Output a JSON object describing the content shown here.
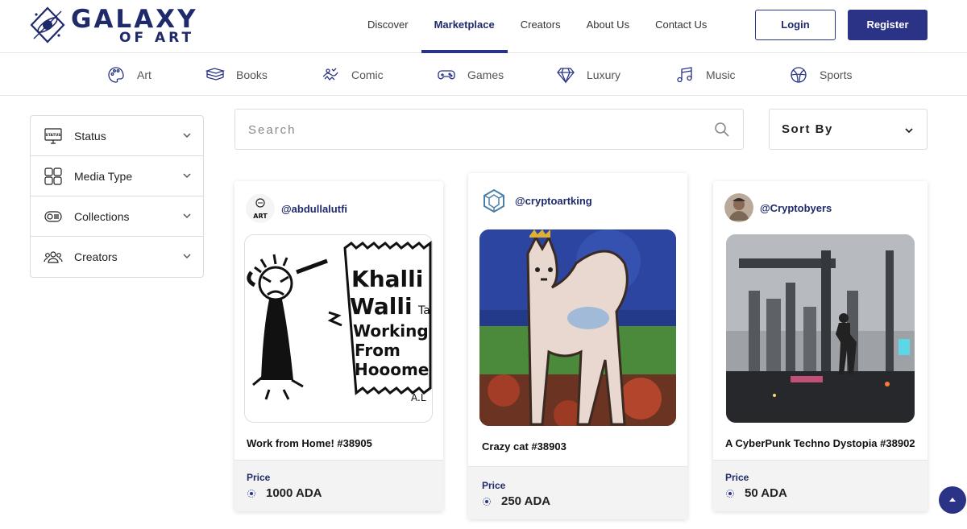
{
  "brand": {
    "line1": "GALAXY",
    "line2": "OF ART"
  },
  "nav": [
    {
      "label": "Discover",
      "active": false
    },
    {
      "label": "Marketplace",
      "active": true
    },
    {
      "label": "Creators",
      "active": false
    },
    {
      "label": "About Us",
      "active": false
    },
    {
      "label": "Contact Us",
      "active": false
    }
  ],
  "auth": {
    "login": "Login",
    "register": "Register"
  },
  "categories": [
    {
      "label": "Art",
      "icon": "palette-icon"
    },
    {
      "label": "Books",
      "icon": "books-icon"
    },
    {
      "label": "Comic",
      "icon": "comic-icon"
    },
    {
      "label": "Games",
      "icon": "gamepad-icon"
    },
    {
      "label": "Luxury",
      "icon": "diamond-icon"
    },
    {
      "label": "Music",
      "icon": "music-note-icon"
    },
    {
      "label": "Sports",
      "icon": "ball-icon"
    }
  ],
  "filters": [
    {
      "label": "Status",
      "icon": "status-icon"
    },
    {
      "label": "Media Type",
      "icon": "grid-icon"
    },
    {
      "label": "Collections",
      "icon": "collection-icon"
    },
    {
      "label": "Creators",
      "icon": "people-icon"
    }
  ],
  "search": {
    "placeholder": "Search"
  },
  "sort": {
    "label": "Sort By"
  },
  "cards": [
    {
      "creator": "@abdullalutfi",
      "avatar_text": "ART",
      "title": "Work from Home! #38905",
      "price_label": "Price",
      "price": "1000 ADA",
      "art_text": [
        "Khalli",
        "Walli",
        "Working",
        "From",
        "Hooome"
      ],
      "signature": "A.L",
      "art_side_text": "Ta"
    },
    {
      "creator": "@cryptoartking",
      "title": "Crazy cat #38903",
      "price_label": "Price",
      "price": "250 ADA"
    },
    {
      "creator": "@Cryptobyers",
      "title": "A CyberPunk Techno Dystopia #38902",
      "price_label": "Price",
      "price": "50 ADA"
    }
  ],
  "colors": {
    "brand": "#1f2a6b",
    "accent": "#2a3385"
  }
}
